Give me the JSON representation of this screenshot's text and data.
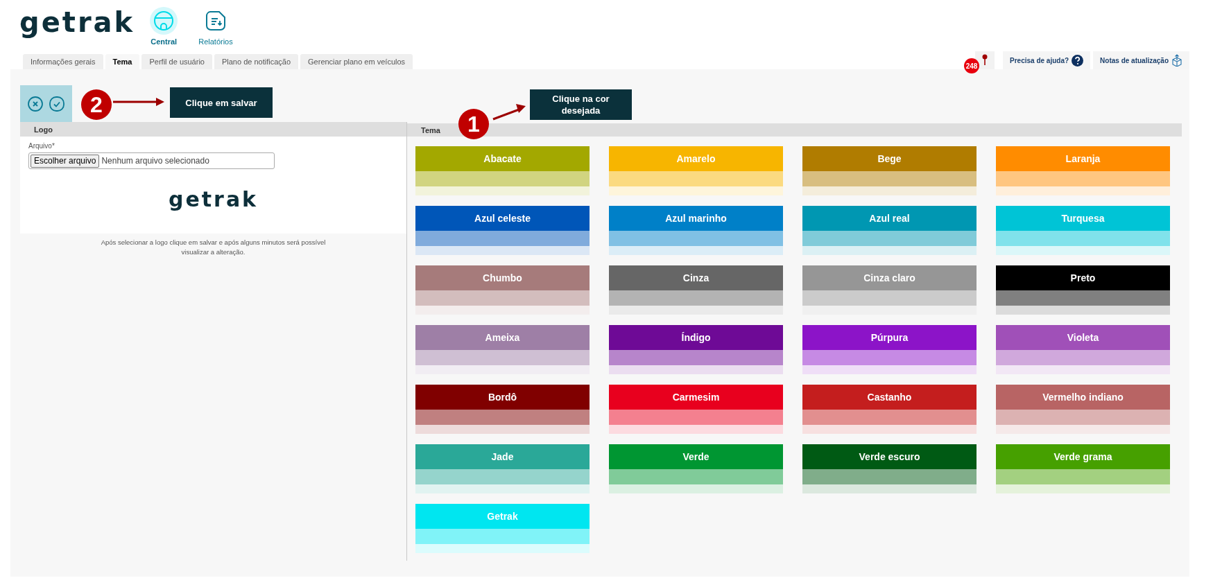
{
  "header": {
    "logo": "getrak",
    "nav": [
      {
        "label": "Central",
        "selected": true,
        "kind": "central"
      },
      {
        "label": "Relatórios",
        "selected": false,
        "kind": "reports"
      }
    ]
  },
  "tabs": [
    {
      "label": "Informações gerais",
      "selected": false
    },
    {
      "label": "Tema",
      "selected": true
    },
    {
      "label": "Perfil de usuário",
      "selected": false
    },
    {
      "label": "Plano de notificação",
      "selected": false
    },
    {
      "label": "Gerenciar plano em veículos",
      "selected": false
    }
  ],
  "top_right": {
    "notification_count": "248",
    "help": "Precisa de ajuda?",
    "release_notes": "Notas de atualização"
  },
  "annotations": [
    {
      "number": "2",
      "text": "Clique em salvar",
      "kind": "save"
    },
    {
      "number": "1",
      "text": "Clique na cor desejada",
      "kind": "color"
    }
  ],
  "logo_panel": {
    "title": "Logo",
    "field_label": "Arquivo*",
    "file_button": "Escolher arquivo",
    "file_status": "Nenhum arquivo selecionado",
    "preview_logo": "getrak",
    "note": "Após selecionar a logo clique em salvar e após alguns minutos será possível visualizar a alteração."
  },
  "theme_panel": {
    "title": "Tema",
    "swatches": [
      {
        "name": "Abacate",
        "color": "#a3a800"
      },
      {
        "name": "Amarelo",
        "color": "#f7b500"
      },
      {
        "name": "Bege",
        "color": "#b07c00"
      },
      {
        "name": "Laranja",
        "color": "#ff8c00"
      },
      {
        "name": "Azul celeste",
        "color": "#0056b8"
      },
      {
        "name": "Azul marinho",
        "color": "#0080c8"
      },
      {
        "name": "Azul real",
        "color": "#0097b2"
      },
      {
        "name": "Turquesa",
        "color": "#00c4d6"
      },
      {
        "name": "Chumbo",
        "color": "#a67b7b"
      },
      {
        "name": "Cinza",
        "color": "#666666"
      },
      {
        "name": "Cinza claro",
        "color": "#969696"
      },
      {
        "name": "Preto",
        "color": "#000000"
      },
      {
        "name": "Ameixa",
        "color": "#9e7fa6"
      },
      {
        "name": "Índigo",
        "color": "#6e0a96"
      },
      {
        "name": "Púrpura",
        "color": "#8c14c8"
      },
      {
        "name": "Violeta",
        "color": "#a050b8"
      },
      {
        "name": "Bordô",
        "color": "#800000"
      },
      {
        "name": "Carmesim",
        "color": "#e8001e"
      },
      {
        "name": "Castanho",
        "color": "#c41e1e"
      },
      {
        "name": "Vermelho indiano",
        "color": "#b86464"
      },
      {
        "name": "Jade",
        "color": "#2aa898"
      },
      {
        "name": "Verde",
        "color": "#009632"
      },
      {
        "name": "Verde escuro",
        "color": "#005a14"
      },
      {
        "name": "Verde grama",
        "color": "#46a000"
      },
      {
        "name": "Getrak",
        "color": "#00e6f0"
      }
    ]
  }
}
